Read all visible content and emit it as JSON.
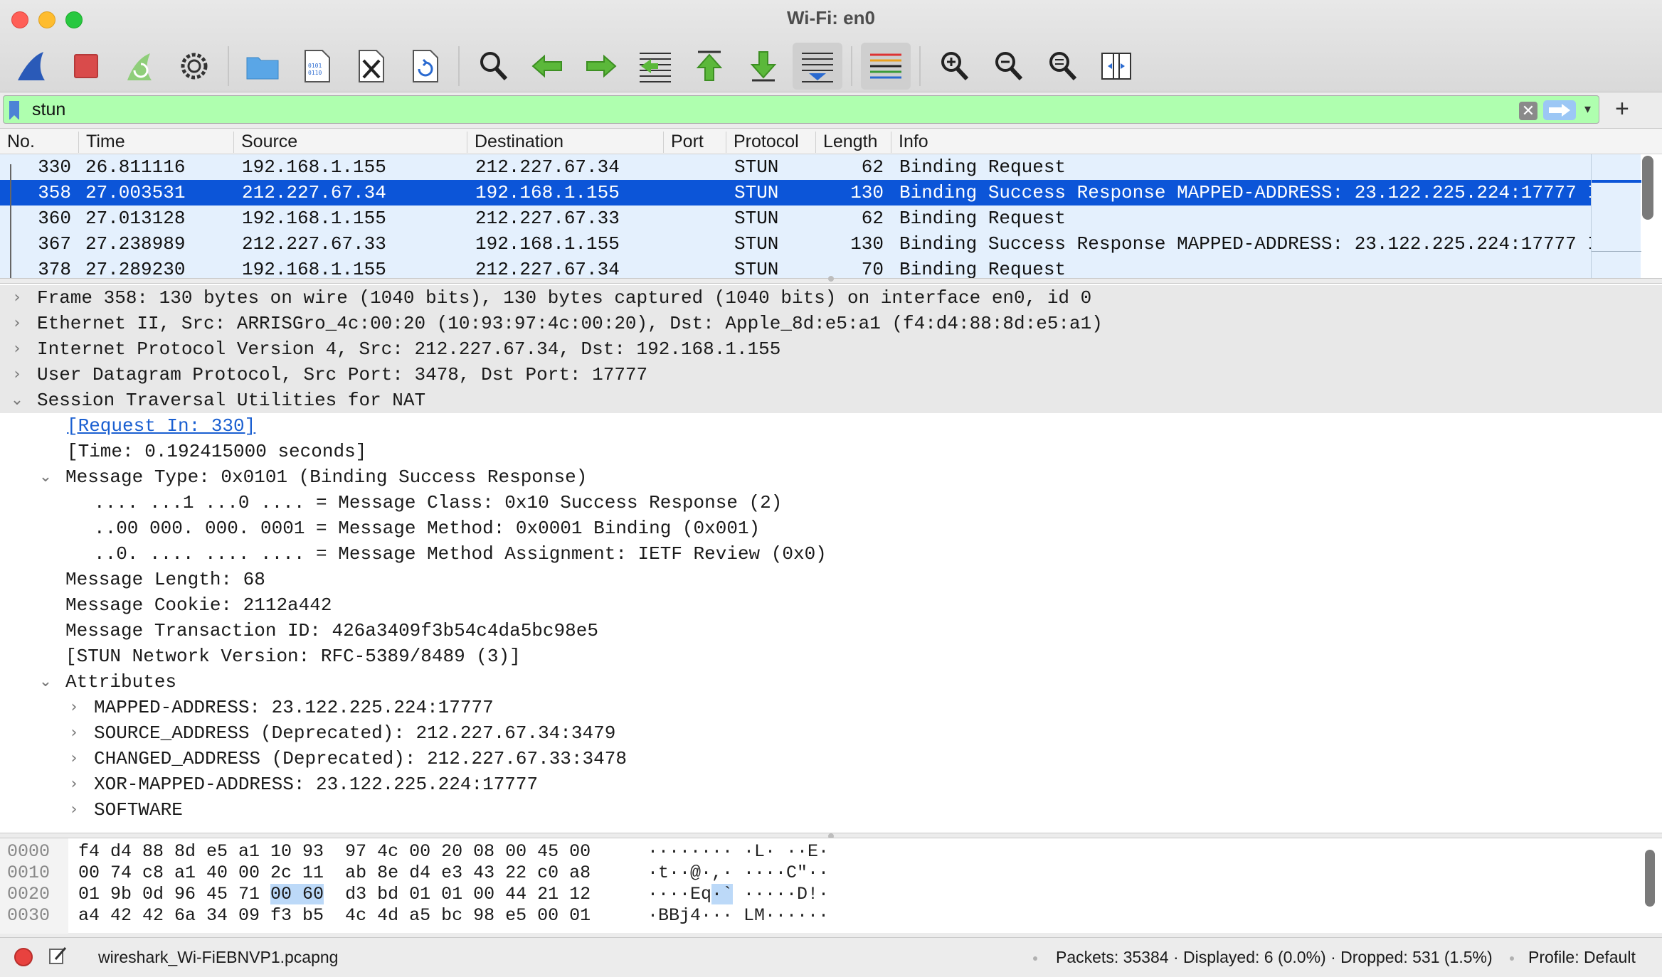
{
  "window": {
    "title": "Wi-Fi: en0"
  },
  "toolbar": {
    "buttons": [
      "start-capture",
      "stop-capture",
      "restart-capture",
      "capture-options",
      "open-file",
      "save-file",
      "close-file",
      "reload-file",
      "find-packet",
      "go-back",
      "go-forward",
      "go-to-packet",
      "go-first",
      "go-last",
      "auto-scroll",
      "colorize",
      "zoom-in",
      "zoom-out",
      "zoom-normal",
      "resize-columns"
    ]
  },
  "filter": {
    "value": "stun",
    "clear_glyph": "✕",
    "dropdown_glyph": "▾",
    "add_glyph": "+"
  },
  "packet_list": {
    "columns": [
      "No.",
      "Time",
      "Source",
      "Destination",
      "Port",
      "Protocol",
      "Length",
      "Info"
    ],
    "rows": [
      {
        "no": "330",
        "time": "26.811116",
        "src": "192.168.1.155",
        "dst": "212.227.67.34",
        "proto": "STUN",
        "len": "62",
        "info": "Binding Request"
      },
      {
        "no": "358",
        "time": "27.003531",
        "src": "212.227.67.34",
        "dst": "192.168.1.155",
        "proto": "STUN",
        "len": "130",
        "info": "Binding Success Response MAPPED-ADDRESS: 23.122.225.224:17777 I"
      },
      {
        "no": "360",
        "time": "27.013128",
        "src": "192.168.1.155",
        "dst": "212.227.67.33",
        "proto": "STUN",
        "len": "62",
        "info": "Binding Request"
      },
      {
        "no": "367",
        "time": "27.238989",
        "src": "212.227.67.33",
        "dst": "192.168.1.155",
        "proto": "STUN",
        "len": "130",
        "info": "Binding Success Response MAPPED-ADDRESS: 23.122.225.224:17777 I"
      },
      {
        "no": "378",
        "time": "27.289230",
        "src": "192.168.1.155",
        "dst": "212.227.67.34",
        "proto": "STUN",
        "len": "70",
        "info": "Binding Request"
      }
    ]
  },
  "details": {
    "lines": [
      {
        "text": "Frame 358: 130 bytes on wire (1040 bits), 130 bytes captured (1040 bits) on interface en0, id 0",
        "arrow": "›"
      },
      {
        "text": "Ethernet II, Src: ARRISGro_4c:00:20 (10:93:97:4c:00:20), Dst: Apple_8d:e5:a1 (f4:d4:88:8d:e5:a1)",
        "arrow": "›"
      },
      {
        "text": "Internet Protocol Version 4, Src: 212.227.67.34, Dst: 192.168.1.155",
        "arrow": "›"
      },
      {
        "text": "User Datagram Protocol, Src Port: 3478, Dst Port: 17777",
        "arrow": "›"
      },
      {
        "text": "Session Traversal Utilities for NAT",
        "arrow": "⌄"
      },
      {
        "text": "[Request In: 330]"
      },
      {
        "text": "[Time: 0.192415000 seconds]"
      },
      {
        "text": "Message Type: 0x0101 (Binding Success Response)",
        "arrow": "⌄"
      },
      {
        "text": ".... ...1 ...0 .... = Message Class: 0x10 Success Response (2)"
      },
      {
        "text": "..00 000. 000. 0001 = Message Method: 0x0001 Binding (0x001)"
      },
      {
        "text": "..0. .... .... .... = Message Method Assignment: IETF Review (0x0)"
      },
      {
        "text": "Message Length: 68"
      },
      {
        "text": "Message Cookie: 2112a442"
      },
      {
        "text": "Message Transaction ID: 426a3409f3b54c4da5bc98e5"
      },
      {
        "text": "[STUN Network Version: RFC-5389/8489 (3)]"
      },
      {
        "text": "Attributes",
        "arrow": "⌄"
      },
      {
        "text": "MAPPED-ADDRESS: 23.122.225.224:17777",
        "arrow": "›"
      },
      {
        "text": "SOURCE_ADDRESS (Deprecated): 212.227.67.34:3479",
        "arrow": "›"
      },
      {
        "text": "CHANGED_ADDRESS (Deprecated): 212.227.67.33:3478",
        "arrow": "›"
      },
      {
        "text": "XOR-MAPPED-ADDRESS: 23.122.225.224:17777",
        "arrow": "›"
      },
      {
        "text": "SOFTWARE",
        "arrow": "›"
      }
    ]
  },
  "hex": {
    "rows": [
      {
        "offset": "0000",
        "bytes_a": "f4 d4 88 8d e5 a1 10 93  97 4c 00 20 08 00 45 00",
        "ascii": "········ ·L· ··E·"
      },
      {
        "offset": "0010",
        "bytes_a": "00 74 c8 a1 40 00 2c 11  ab 8e d4 e3 43 22 c0 a8",
        "ascii": "·t··@·,· ····C\"··"
      },
      {
        "offset": "0020",
        "bytes_pre": "01 9b 0d 96 45 71 ",
        "bytes_hl": "00 60",
        "bytes_post": "  d3 bd 01 01 00 44 21 12",
        "ascii_pre": "····Eq",
        "ascii_hl": "·`",
        "ascii_post": " ·····D!·"
      },
      {
        "offset": "0030",
        "bytes_a": "a4 42 42 6a 34 09 f3 b5  4c 4d a5 bc 98 e5 00 01",
        "ascii": "·BBj4··· LM······"
      }
    ]
  },
  "status": {
    "file": "wireshark_Wi-FiEBNVP1.pcapng",
    "stats": "Packets: 35384 · Displayed: 6 (0.0%) · Dropped: 531 (1.5%)",
    "profile": "Profile: Default"
  },
  "colors": {
    "filter_ok": "#afffaf",
    "row_bg": "#e4f0fd",
    "row_selected": "#0c55d8",
    "link": "#1a5fd1"
  }
}
